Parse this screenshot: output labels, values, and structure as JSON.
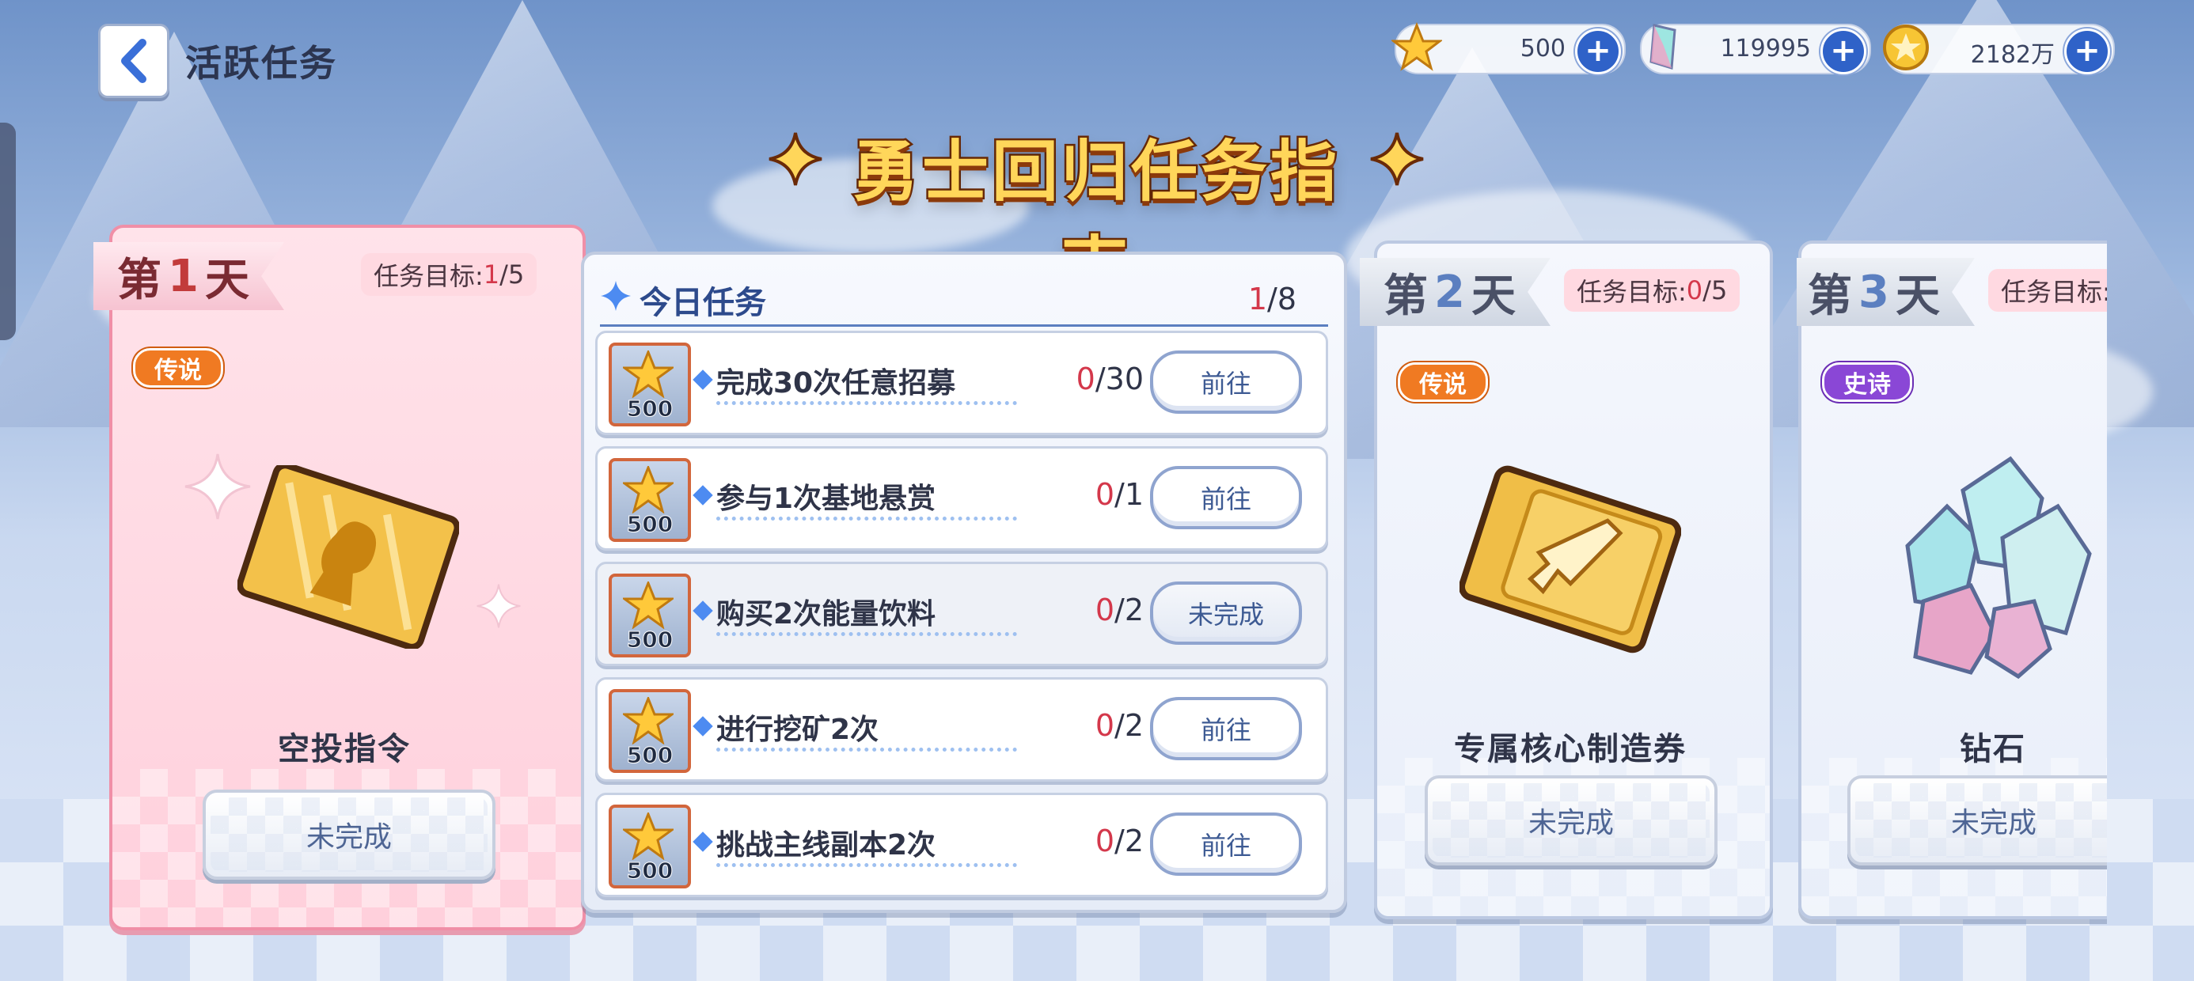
{
  "header": {
    "title": "活跃任务",
    "currencies": [
      {
        "icon": "star-icon",
        "value": "500"
      },
      {
        "icon": "crystal-icon",
        "value": "119995"
      },
      {
        "icon": "gold-coin-icon",
        "value": "2182万"
      }
    ]
  },
  "banner": {
    "title": "勇士回归任务指南"
  },
  "days": [
    {
      "prefix": "第",
      "num": "1",
      "suffix": "天",
      "goal_label": "任务目标: ",
      "goal_done": "1",
      "goal_total": "/5",
      "rarity": "传说",
      "reward": "空投指令",
      "status": "未完成"
    },
    {
      "prefix": "第",
      "num": "2",
      "suffix": "天",
      "goal_label": "任务目标: ",
      "goal_done": "0",
      "goal_total": "/5",
      "rarity": "传说",
      "reward": "专属核心制造券",
      "status": "未完成"
    },
    {
      "prefix": "第",
      "num": "3",
      "suffix": "天",
      "goal_label": "任务目标: ",
      "goal_done": "",
      "goal_total": "",
      "rarity": "史诗",
      "reward": "钻石",
      "status": "未完成"
    }
  ],
  "tasks": {
    "title": "今日任务",
    "done": "1",
    "total": "/8",
    "items": [
      {
        "reward": "500",
        "text": "完成30次任意招募",
        "done": "0",
        "total": "/30",
        "action": "前往"
      },
      {
        "reward": "500",
        "text": "参与1次基地悬赏",
        "done": "0",
        "total": "/1",
        "action": "前往"
      },
      {
        "reward": "500",
        "text": "购买2次能量饮料",
        "done": "0",
        "total": "/2",
        "action": "未完成"
      },
      {
        "reward": "500",
        "text": "进行挖矿2次",
        "done": "0",
        "total": "/2",
        "action": "前往"
      },
      {
        "reward": "500",
        "text": "挑战主线副本2次",
        "done": "0",
        "total": "/2",
        "action": "前往"
      }
    ]
  },
  "colors": {
    "accent": "#2f62c8",
    "progress_red": "#d4384b",
    "legend": "#f07a22",
    "epic": "#8a47d6"
  }
}
